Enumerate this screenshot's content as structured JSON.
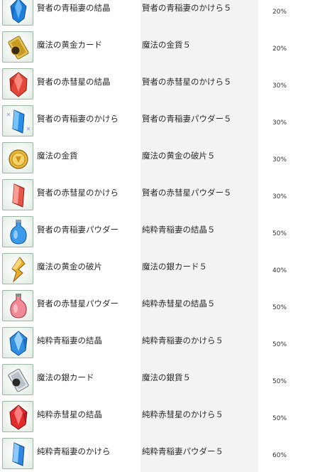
{
  "rows": [
    {
      "icon": "blue-crystal-icon",
      "item": "賢者の青稲妻の結晶",
      "result": "賢者の青稲妻のかけら５",
      "rate": "20%"
    },
    {
      "icon": "gold-card-icon",
      "item": "魔法の黄金カード",
      "result": "魔法の金貨５",
      "rate": "20%"
    },
    {
      "icon": "red-crystal-icon",
      "item": "賢者の赤彗星の結晶",
      "result": "賢者の赤彗星のかけら５",
      "rate": "30%"
    },
    {
      "icon": "blue-shard-icon",
      "item": "賢者の青稲妻のかけら",
      "result": "賢者の青稲妻パウダー５",
      "rate": "30%"
    },
    {
      "icon": "gold-coin-icon",
      "item": "魔法の金貨",
      "result": "魔法の黄金の破片５",
      "rate": "30%"
    },
    {
      "icon": "red-shard-icon",
      "item": "賢者の赤彗星のかけら",
      "result": "賢者の赤彗星パウダー５",
      "rate": "30%"
    },
    {
      "icon": "blue-powder-icon",
      "item": "賢者の青稲妻パウダー",
      "result": "純粋青稲妻の結晶５",
      "rate": "50%"
    },
    {
      "icon": "gold-fragment-icon",
      "item": "魔法の黄金の破片",
      "result": "魔法の銀カード５",
      "rate": "40%"
    },
    {
      "icon": "red-powder-icon",
      "item": "賢者の赤彗星パウダー",
      "result": "純粋赤彗星の結晶５",
      "rate": "50%"
    },
    {
      "icon": "pure-blue-crystal-icon",
      "item": "純粋青稲妻の結晶",
      "result": "純粋青稲妻のかけら５",
      "rate": "50%"
    },
    {
      "icon": "silver-card-icon",
      "item": "魔法の銀カード",
      "result": "魔法の銀貨５",
      "rate": "50%"
    },
    {
      "icon": "pure-red-crystal-icon",
      "item": "純粋赤彗星の結晶",
      "result": "純粋赤彗星のかけら５",
      "rate": "50%"
    },
    {
      "icon": "pure-blue-shard-icon",
      "item": "純粋青稲妻のかけら",
      "result": "純粋青稲妻パウダー５",
      "rate": "60%"
    }
  ]
}
